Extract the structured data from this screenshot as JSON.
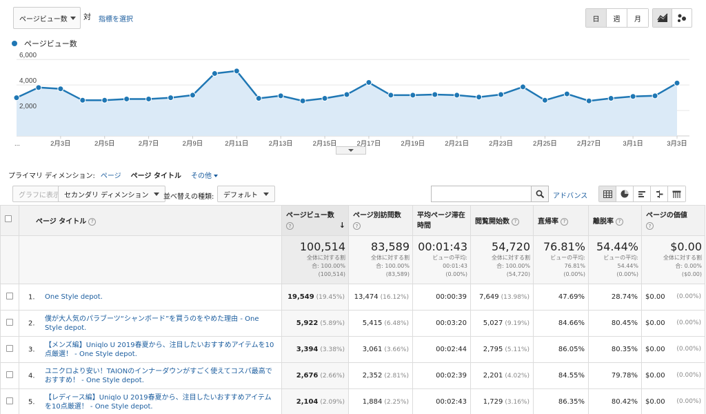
{
  "header": {
    "metric": "ページビュー数",
    "vs": "対",
    "choose_metric": "指標を選択",
    "periods": [
      "日",
      "週",
      "月"
    ],
    "active_period": 0
  },
  "legend": {
    "label": "ページビュー数"
  },
  "colors": {
    "series": "#1f77b4",
    "area": "#dbeaf7",
    "link": "#1a5c9e"
  },
  "chart_data": {
    "type": "area",
    "x": [
      "2月1日",
      "2月2日",
      "2月3日",
      "2月4日",
      "2月5日",
      "2月6日",
      "2月7日",
      "2月8日",
      "2月9日",
      "2月10日",
      "2月11日",
      "2月12日",
      "2月13日",
      "2月14日",
      "2月15日",
      "2月16日",
      "2月17日",
      "2月18日",
      "2月19日",
      "2月20日",
      "2月21日",
      "2月22日",
      "2月23日",
      "2月24日",
      "2月25日",
      "2月26日",
      "2月27日",
      "2月28日",
      "3月1日",
      "3月2日",
      "3月3日"
    ],
    "series": [
      {
        "name": "ページビュー数",
        "values": [
          3000,
          3800,
          3700,
          2800,
          2800,
          2900,
          2900,
          3000,
          3200,
          4900,
          5100,
          2950,
          3150,
          2750,
          2950,
          3250,
          4200,
          3200,
          3200,
          3250,
          3200,
          3050,
          3250,
          3850,
          2800,
          3300,
          2750,
          2950,
          3100,
          3150,
          4150
        ]
      },
      {
        "values": [
          3200,
          4000,
          3900,
          3000,
          3000,
          3100,
          3100,
          3200,
          3400,
          5100,
          5300,
          3150,
          3350,
          2950,
          3150,
          3450,
          4400,
          3400,
          3400,
          3450,
          3400,
          3250,
          3450,
          4050,
          3000,
          3500,
          2950,
          3150,
          3300,
          3350,
          4350
        ]
      }
    ],
    "y_ticks": [
      "2,000",
      "4,000",
      "6,000"
    ],
    "x_tick_labels": [
      "...",
      "2月3日",
      "2月5日",
      "2月7日",
      "2月9日",
      "2月11日",
      "2月13日",
      "2月15日",
      "2月17日",
      "2月19日",
      "2月21日",
      "2月23日",
      "2月25日",
      "2月27日",
      "3月1日",
      "3月3日"
    ],
    "ylim": [
      0,
      6500
    ],
    "grid": true,
    "legend_placement": "top-left"
  },
  "dimension": {
    "label": "プライマリ ディメンション:",
    "options": [
      "ページ",
      "ページ タイトル",
      "その他"
    ],
    "active": 1
  },
  "toolbar": {
    "plot_rows": "グラフに表示",
    "secondary": "セカンダリ ディメンション",
    "sort_label": "並べ替えの種類:",
    "sort_value": "デフォルト",
    "search_value": "",
    "advanced": "アドバンス"
  },
  "table": {
    "columns": [
      "ページ タイトル",
      "ページビュー数",
      "ページ別訪問数",
      "平均ページ滞在時間",
      "閲覧開始数",
      "直帰率",
      "離脱率",
      "ページの価値"
    ],
    "totals": [
      {
        "value": "100,514",
        "sub1": "全体に対する割",
        "sub2": "合: 100.00%",
        "sub3": "(100,514)"
      },
      {
        "value": "83,589",
        "sub1": "全体に対する割",
        "sub2": "合: 100.00%",
        "sub3": "(83,589)"
      },
      {
        "value": "00:01:43",
        "sub1": "ビューの平均:",
        "sub2": "00:01:43",
        "sub3": "(0.00%)"
      },
      {
        "value": "54,720",
        "sub1": "全体に対する割",
        "sub2": "合: 100.00%",
        "sub3": "(54,720)"
      },
      {
        "value": "76.81%",
        "sub1": "ビューの平均:",
        "sub2": "76.81%",
        "sub3": "(0.00%)"
      },
      {
        "value": "54.44%",
        "sub1": "ビューの平均:",
        "sub2": "54.44%",
        "sub3": "(0.00%)"
      },
      {
        "value": "$0.00",
        "sub1": "全体に対する割",
        "sub2": "合: 0.00%",
        "sub3": "($0.00)"
      }
    ],
    "rows": [
      {
        "idx": "1.",
        "title": "One Style depot.",
        "pv": "19,549",
        "pv_pct": "(19.45%)",
        "upv": "13,474",
        "upv_pct": "(16.12%)",
        "time": "00:00:39",
        "ent": "7,649",
        "ent_pct": "(13.98%)",
        "bounce": "47.69%",
        "exit": "28.74%",
        "val": "$0.00",
        "val_pct": "(0.00%)"
      },
      {
        "idx": "2.",
        "title": "僕が大人気のパラブーツ“シャンボード”を買うのをやめた理由 - One Style depot.",
        "pv": "5,922",
        "pv_pct": "(5.89%)",
        "upv": "5,415",
        "upv_pct": "(6.48%)",
        "time": "00:03:20",
        "ent": "5,027",
        "ent_pct": "(9.19%)",
        "bounce": "84.66%",
        "exit": "80.45%",
        "val": "$0.00",
        "val_pct": "(0.00%)"
      },
      {
        "idx": "3.",
        "title": "【メンズ編】Uniqlo U 2019春夏から、注目したいおすすめアイテムを10点厳選！ - One Style depot.",
        "pv": "3,394",
        "pv_pct": "(3.38%)",
        "upv": "3,061",
        "upv_pct": "(3.66%)",
        "time": "00:02:44",
        "ent": "2,795",
        "ent_pct": "(5.11%)",
        "bounce": "86.05%",
        "exit": "80.35%",
        "val": "$0.00",
        "val_pct": "(0.00%)"
      },
      {
        "idx": "4.",
        "title": "ユニクロより安い！TAIONのインナーダウンがすごく使えてコスパ最高でおすすめ！ - One Style depot.",
        "pv": "2,676",
        "pv_pct": "(2.66%)",
        "upv": "2,352",
        "upv_pct": "(2.81%)",
        "time": "00:02:39",
        "ent": "2,201",
        "ent_pct": "(4.02%)",
        "bounce": "84.55%",
        "exit": "79.78%",
        "val": "$0.00",
        "val_pct": "(0.00%)"
      },
      {
        "idx": "5.",
        "title": "【レディース編】Uniqlo U 2019春夏から、注目したいおすすめアイテムを10点厳選！ - One Style depot.",
        "pv": "2,104",
        "pv_pct": "(2.09%)",
        "upv": "1,884",
        "upv_pct": "(2.25%)",
        "time": "00:02:43",
        "ent": "1,729",
        "ent_pct": "(3.16%)",
        "bounce": "86.35%",
        "exit": "80.42%",
        "val": "$0.00",
        "val_pct": "(0.00%)"
      }
    ]
  }
}
